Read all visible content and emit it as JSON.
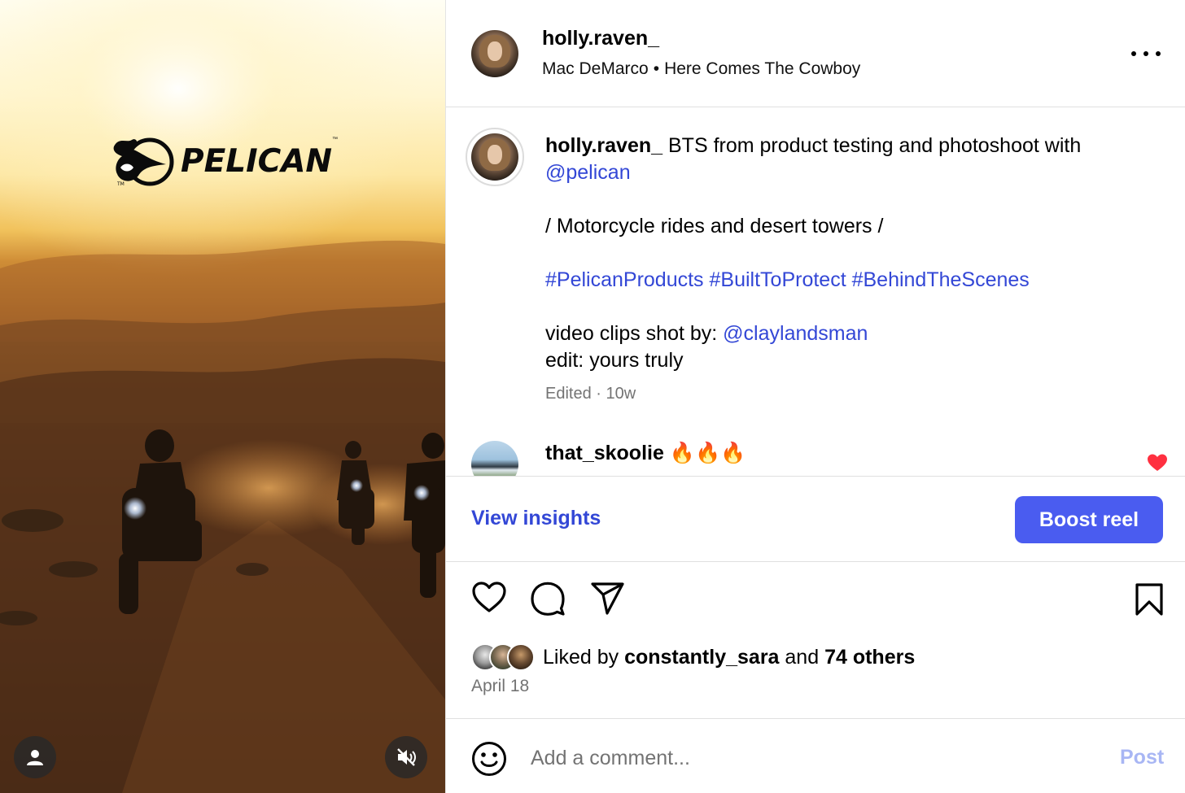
{
  "media": {
    "brand_logo_text": "PELICAN",
    "brand_logo_tm": "™",
    "profile_button_icon": "person-icon",
    "mute_button_icon": "speaker-muted-icon"
  },
  "header": {
    "username": "holly.raven_",
    "audio_artist": "Mac DeMarco",
    "audio_separator": "•",
    "audio_track": "Here Comes The Cowboy",
    "more_icon": "more-horizontal-icon"
  },
  "caption": {
    "username": "holly.raven_",
    "text_line1": "BTS from product testing and photoshoot with",
    "mention1": "@pelican",
    "text_line2": "/ Motorcycle rides and desert towers /",
    "hashtags": "#PelicanProducts #BuiltToProtect #BehindTheScenes",
    "credit_prefix": "video clips shot by:",
    "mention2": "@claylandsman",
    "edit_line": "edit: yours truly",
    "edited_label": "Edited",
    "meta_separator": "·",
    "age": "10w"
  },
  "comments": [
    {
      "username": "that_skoolie",
      "text": "🔥🔥🔥",
      "liked": true
    }
  ],
  "insights": {
    "view_label": "View insights",
    "boost_label": "Boost reel"
  },
  "actions": {
    "like_icon": "heart-icon",
    "comment_icon": "comment-icon",
    "share_icon": "share-icon",
    "save_icon": "bookmark-icon",
    "liked_prefix": "Liked by",
    "liked_user": "constantly_sara",
    "liked_mid": "and",
    "liked_others": "74 others",
    "date": "April 18"
  },
  "comment_box": {
    "placeholder": "Add a comment...",
    "post_label": "Post",
    "emoji_icon": "smiley-icon"
  },
  "colors": {
    "link": "#3347d6",
    "boost_button": "#4a5cf0",
    "post_disabled": "#a8b6f4",
    "like_red": "#ff3040"
  }
}
